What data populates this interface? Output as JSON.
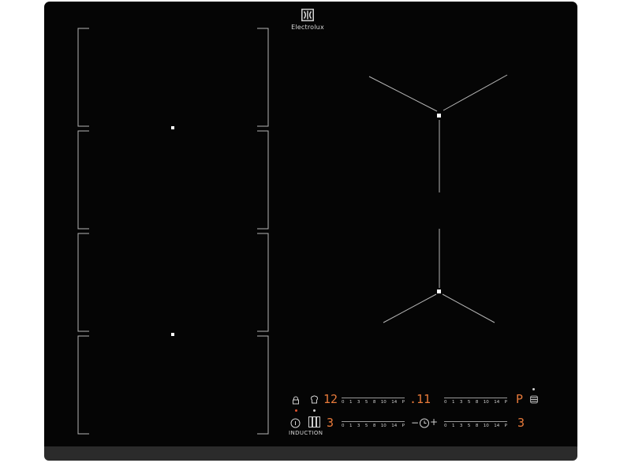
{
  "brand": {
    "name": "Electrolux",
    "logo_icon": "electrolux-logo-icon"
  },
  "panel": {
    "left_display": "12",
    "timer_display": ".11",
    "right_display": "P",
    "bottom_left_display": "3",
    "bottom_right_display": "3",
    "induction_label": "INDUCTION",
    "minus_label": "−",
    "plus_label": "+"
  },
  "scales": [
    {
      "name": "top-left",
      "labels": [
        "0",
        "1",
        "3",
        "5",
        "8",
        "10",
        "14",
        "P"
      ]
    },
    {
      "name": "top-right",
      "labels": [
        "0",
        "1",
        "3",
        "5",
        "8",
        "10",
        "14",
        "P"
      ]
    },
    {
      "name": "bottom-left",
      "labels": [
        "0",
        "1",
        "3",
        "5",
        "8",
        "10",
        "14",
        "P"
      ]
    },
    {
      "name": "bottom-right",
      "labels": [
        "0",
        "1",
        "3",
        "5",
        "8",
        "10",
        "14",
        "P"
      ]
    }
  ],
  "icons": {
    "lock": "lock-icon",
    "chef": "chef-hat-icon",
    "power": "power-icon",
    "bridge": "bridge-icon",
    "timer": "timer-icon",
    "hood": "hob-to-hood-icon"
  },
  "colors": {
    "glass": "#050505",
    "display": "#e87a3a",
    "outline": "#b0b0b0",
    "indicator": "#e0522c"
  }
}
